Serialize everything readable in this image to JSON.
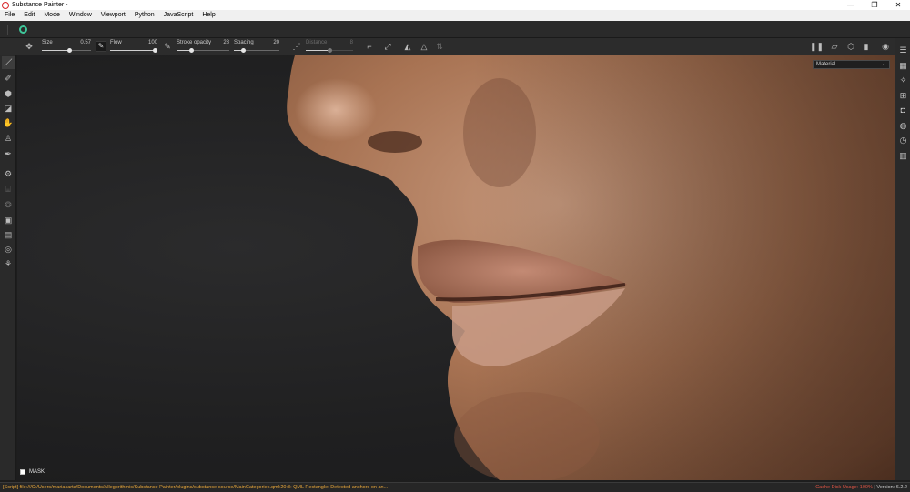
{
  "window": {
    "title": "Substance Painter -",
    "controls": {
      "minimize": "—",
      "maximize": "❐",
      "close": "✕"
    }
  },
  "menu": [
    "File",
    "Edit",
    "Mode",
    "Window",
    "Viewport",
    "Python",
    "JavaScript",
    "Help"
  ],
  "toolbar": {
    "size": {
      "label": "Size",
      "value": "0.57",
      "fraction": 0.57
    },
    "flow": {
      "label": "Flow",
      "value": "100",
      "fraction": 1.0
    },
    "stroke_opacity": {
      "label": "Stroke opacity",
      "value": "28",
      "fraction": 0.28
    },
    "spacing": {
      "label": "Spacing",
      "value": "20",
      "fraction": 0.2
    },
    "distance": {
      "label": "Distance",
      "value": "8",
      "fraction": 0.5
    }
  },
  "viewport": {
    "render_mode": "Material",
    "mask_label": "MASK"
  },
  "statusbar": {
    "log": "[Script] file:///C:/Users/mariacarta/Documents/Allegorithmic/Substance Painter/plugins/substance-source/MainCategories.qml:20:3: QML Rectangle: Detected anchors on an...",
    "cache": "Cache Disk Usage: 100%",
    "separator": "|",
    "version": "Version: 6.2.2"
  },
  "icons": {
    "left": [
      "brush-icon",
      "eraser-icon",
      "projection-icon",
      "polygon-fill-icon",
      "smudge-icon",
      "clone-stamp-icon",
      "color-picker-icon",
      "geometry-mask-icon",
      "bake-icon",
      "sphere-icon",
      "photoshop-export-icon",
      "document-icon",
      "settings-icon",
      "share-icon"
    ],
    "right": [
      "layers-icon",
      "texture-set-icon",
      "shader-icon",
      "uv-grid-icon",
      "display-settings-icon",
      "world-icon",
      "history-icon",
      "log-icon"
    ]
  },
  "colors": {
    "accent_green": "#3ec79a",
    "log_orange": "#e8a73a",
    "cache_red": "#e05545",
    "skin": "#b48060"
  }
}
